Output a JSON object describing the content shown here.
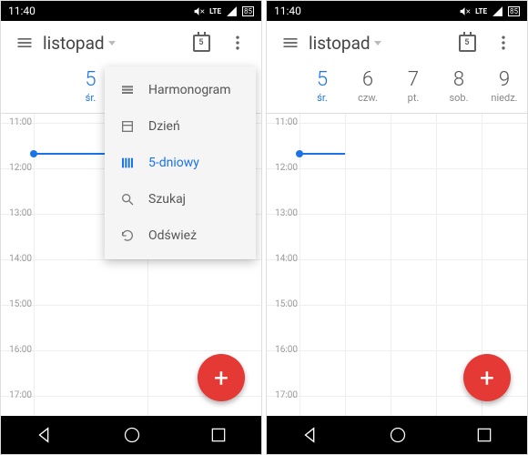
{
  "status": {
    "time": "11:40",
    "lte": "LTE",
    "battery": "85"
  },
  "toolbar": {
    "month": "listopad",
    "today_num": "5"
  },
  "days": [
    {
      "num": "5",
      "label": "śr.",
      "selected": true
    },
    {
      "num": "6",
      "label": "czw.",
      "selected": false
    },
    {
      "num": "7",
      "label": "pt.",
      "selected": false
    },
    {
      "num": "8",
      "label": "sob.",
      "selected": false
    },
    {
      "num": "9",
      "label": "niedz.",
      "selected": false
    }
  ],
  "hours": [
    "11:00",
    "12:00",
    "13:00",
    "14:00",
    "15:00",
    "16:00",
    "17:00"
  ],
  "menu": {
    "schedule": "Harmonogram",
    "day": "Dzień",
    "fiveday": "5-dniowy",
    "search": "Szukaj",
    "refresh": "Odśwież"
  },
  "fab": {
    "plus": "+"
  }
}
